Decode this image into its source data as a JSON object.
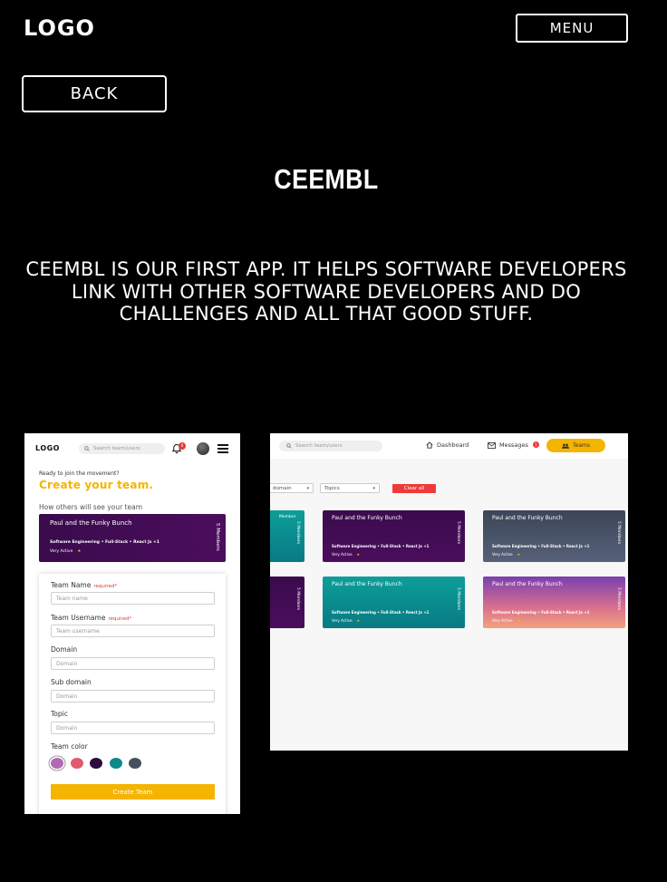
{
  "header": {
    "logo": "LOGO",
    "menu_label": "MENU"
  },
  "back_label": "BACK",
  "title": "CEEMBL",
  "description": "CEEMBL IS OUR FIRST APP. IT HELPS SOFTWARE DEVELOPERS LINK WITH OTHER SOFTWARE DEVELOPERS AND DO CHALLENGES AND ALL THAT GOOD STUFF.",
  "mobile": {
    "logo": "LOGO",
    "search_placeholder": "Search team/users",
    "notification_count": "6",
    "ready_text": "Ready to join the movement?",
    "create_heading": "Create your team.",
    "preview_label": "How others will see your team",
    "preview_card": {
      "name": "Paul and the Funky Bunch",
      "tags": "Software Engineering • Full-Stack • React Js +1",
      "activity": "Very Active",
      "members": "5 Members"
    },
    "form": {
      "team_name_label": "Team Name",
      "team_name_placeholder": "Team name",
      "required_text": "required*",
      "team_username_label": "Team Username",
      "team_username_placeholder": "Team username",
      "domain_label": "Domain",
      "domain_placeholder": "Domain",
      "subdomain_label": "Sub domain",
      "subdomain_placeholder": "Domain",
      "topic_label": "Topic",
      "topic_placeholder": "Domain",
      "color_label": "Team color",
      "colors": [
        "#b06ab3",
        "#e05a6d",
        "#2c0b3f",
        "#0d8a8a",
        "#46505f"
      ],
      "submit_label": "Create Team"
    }
  },
  "desktop": {
    "search_placeholder": "Search team/users",
    "nav": {
      "dashboard": "Dashboard",
      "messages": "Messages",
      "messages_count": "5",
      "teams": "Teams"
    },
    "filters": {
      "domain": "domain",
      "topics": "Topics",
      "clear": "Clear all"
    },
    "partial_card_label": "Member",
    "cards": [
      {
        "name": "Paul and the Funky Bunch",
        "tags": "Software Engineering • Full-Stack • React Js +1",
        "activity": "Very Active",
        "members": "5 Members"
      },
      {
        "name": "Paul and the Funky Bunch",
        "tags": "Software Engineering • Full-Stack • React Js +1",
        "activity": "Very Active",
        "members": "5 Members"
      },
      {
        "name": "Paul and the Funky Bunch",
        "tags": "Software Engineering • Full-Stack • React Js +1",
        "activity": "Very Active",
        "members": "5 Members"
      },
      {
        "name": "Paul and the Funky Bunch",
        "tags": "Software Engineering • Full-Stack • React Js +1",
        "activity": "Very Active",
        "members": "5 Members"
      }
    ],
    "partial_members": [
      "5 Members",
      "5 Members"
    ]
  }
}
